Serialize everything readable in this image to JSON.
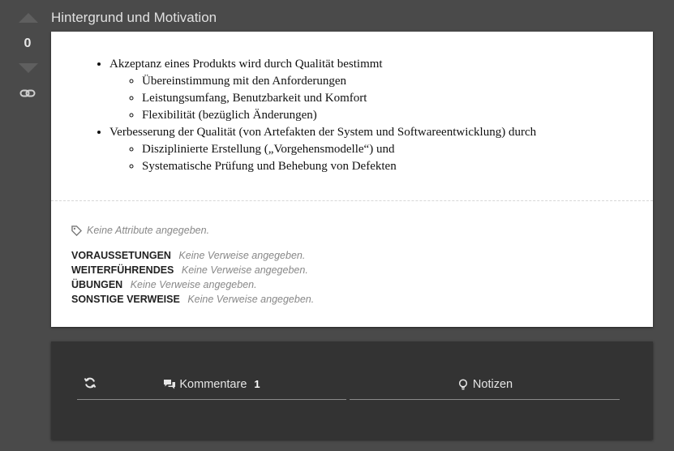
{
  "vote": {
    "count": "0"
  },
  "section": {
    "title": "Hintergrund und Motivation"
  },
  "content": {
    "items": [
      {
        "text": "Akzeptanz eines Produkts wird durch Qualität bestimmt",
        "children": [
          "Übereinstimmung mit den Anforderungen",
          "Leistungsumfang, Benutzbarkeit und Komfort",
          "Flexibilität (bezüglich Änderungen)"
        ]
      },
      {
        "text": "Verbesserung der Qualität (von Artefakten der System und Softwareentwicklung) durch",
        "children": [
          "Disziplinierte Erstellung („Vorgehensmodelle“) und",
          "Systematische Prüfung und Behebung von Defekten"
        ]
      }
    ]
  },
  "attributes": {
    "empty_text": "Keine Attribute angegeben."
  },
  "references": [
    {
      "label": "VORAUSSETUNGEN",
      "value": "Keine Verweise angegeben."
    },
    {
      "label": "WEITERFÜHRENDES",
      "value": "Keine Verweise angegeben."
    },
    {
      "label": "ÜBUNGEN",
      "value": "Keine Verweise angegeben."
    },
    {
      "label": "SONSTIGE VERWEISE",
      "value": "Keine Verweise angegeben."
    }
  ],
  "tabs": {
    "comments_label": "Kommentare",
    "comments_count": "1",
    "notes_label": "Notizen"
  },
  "icons": {
    "vote_up": "triangle-up",
    "vote_down": "triangle-down",
    "link": "chain-link-icon",
    "tag": "tag-icon",
    "refresh": "refresh-icon",
    "comments": "speech-bubbles-icon",
    "notes": "lightbulb-icon"
  }
}
